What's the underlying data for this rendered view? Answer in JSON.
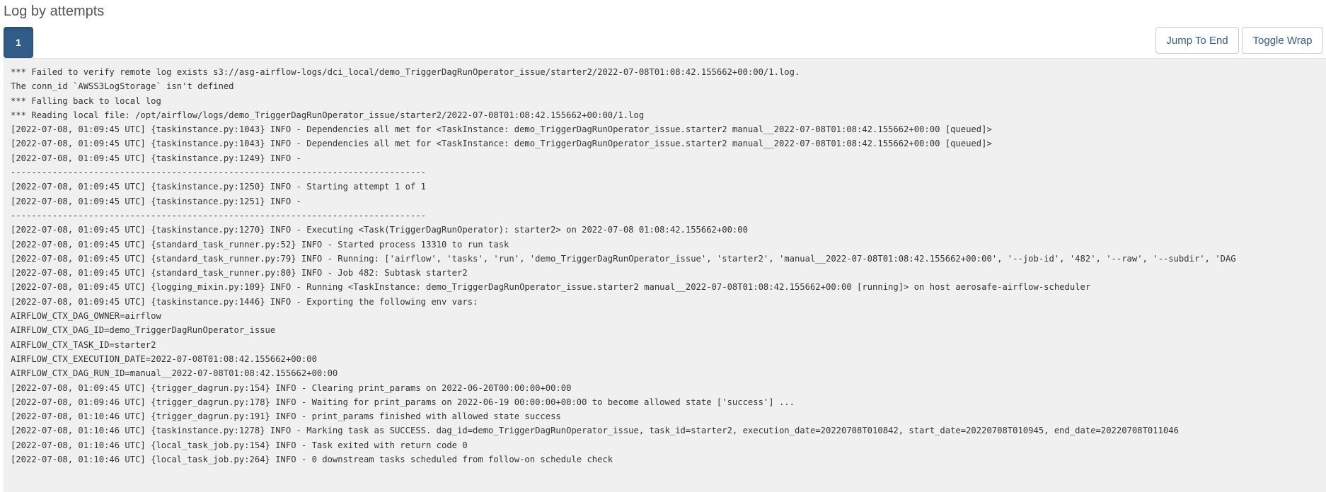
{
  "page": {
    "title": "Log by attempts"
  },
  "attempts": {
    "items": [
      {
        "label": "1",
        "active": true
      }
    ]
  },
  "toolbar": {
    "jump_to_end_label": "Jump To End",
    "toggle_wrap_label": "Toggle Wrap"
  },
  "colors": {
    "accent": "#325d88",
    "log_background": "#f0f0f0",
    "text": "#333333"
  },
  "log": {
    "lines": [
      "*** Failed to verify remote log exists s3://asg-airflow-logs/dci_local/demo_TriggerDagRunOperator_issue/starter2/2022-07-08T01:08:42.155662+00:00/1.log.",
      "The conn_id `AWSS3LogStorage` isn't defined",
      "*** Falling back to local log",
      "*** Reading local file: /opt/airflow/logs/demo_TriggerDagRunOperator_issue/starter2/2022-07-08T01:08:42.155662+00:00/1.log",
      "[2022-07-08, 01:09:45 UTC] {taskinstance.py:1043} INFO - Dependencies all met for <TaskInstance: demo_TriggerDagRunOperator_issue.starter2 manual__2022-07-08T01:08:42.155662+00:00 [queued]>",
      "[2022-07-08, 01:09:45 UTC] {taskinstance.py:1043} INFO - Dependencies all met for <TaskInstance: demo_TriggerDagRunOperator_issue.starter2 manual__2022-07-08T01:08:42.155662+00:00 [queued]>",
      "[2022-07-08, 01:09:45 UTC] {taskinstance.py:1249} INFO - ",
      "--------------------------------------------------------------------------------",
      "[2022-07-08, 01:09:45 UTC] {taskinstance.py:1250} INFO - Starting attempt 1 of 1",
      "[2022-07-08, 01:09:45 UTC] {taskinstance.py:1251} INFO - ",
      "--------------------------------------------------------------------------------",
      "[2022-07-08, 01:09:45 UTC] {taskinstance.py:1270} INFO - Executing <Task(TriggerDagRunOperator): starter2> on 2022-07-08 01:08:42.155662+00:00",
      "[2022-07-08, 01:09:45 UTC] {standard_task_runner.py:52} INFO - Started process 13310 to run task",
      "[2022-07-08, 01:09:45 UTC] {standard_task_runner.py:79} INFO - Running: ['airflow', 'tasks', 'run', 'demo_TriggerDagRunOperator_issue', 'starter2', 'manual__2022-07-08T01:08:42.155662+00:00', '--job-id', '482', '--raw', '--subdir', 'DAG",
      "[2022-07-08, 01:09:45 UTC] {standard_task_runner.py:80} INFO - Job 482: Subtask starter2",
      "[2022-07-08, 01:09:45 UTC] {logging_mixin.py:109} INFO - Running <TaskInstance: demo_TriggerDagRunOperator_issue.starter2 manual__2022-07-08T01:08:42.155662+00:00 [running]> on host aerosafe-airflow-scheduler",
      "[2022-07-08, 01:09:45 UTC] {taskinstance.py:1446} INFO - Exporting the following env vars:",
      "AIRFLOW_CTX_DAG_OWNER=airflow",
      "AIRFLOW_CTX_DAG_ID=demo_TriggerDagRunOperator_issue",
      "AIRFLOW_CTX_TASK_ID=starter2",
      "AIRFLOW_CTX_EXECUTION_DATE=2022-07-08T01:08:42.155662+00:00",
      "AIRFLOW_CTX_DAG_RUN_ID=manual__2022-07-08T01:08:42.155662+00:00",
      "[2022-07-08, 01:09:45 UTC] {trigger_dagrun.py:154} INFO - Clearing print_params on 2022-06-20T00:00:00+00:00",
      "[2022-07-08, 01:09:46 UTC] {trigger_dagrun.py:178} INFO - Waiting for print_params on 2022-06-19 00:00:00+00:00 to become allowed state ['success'] ...",
      "[2022-07-08, 01:10:46 UTC] {trigger_dagrun.py:191} INFO - print_params finished with allowed state success",
      "[2022-07-08, 01:10:46 UTC] {taskinstance.py:1278} INFO - Marking task as SUCCESS. dag_id=demo_TriggerDagRunOperator_issue, task_id=starter2, execution_date=20220708T010842, start_date=20220708T010945, end_date=20220708T011046",
      "[2022-07-08, 01:10:46 UTC] {local_task_job.py:154} INFO - Task exited with return code 0",
      "[2022-07-08, 01:10:46 UTC] {local_task_job.py:264} INFO - 0 downstream tasks scheduled from follow-on schedule check"
    ]
  }
}
